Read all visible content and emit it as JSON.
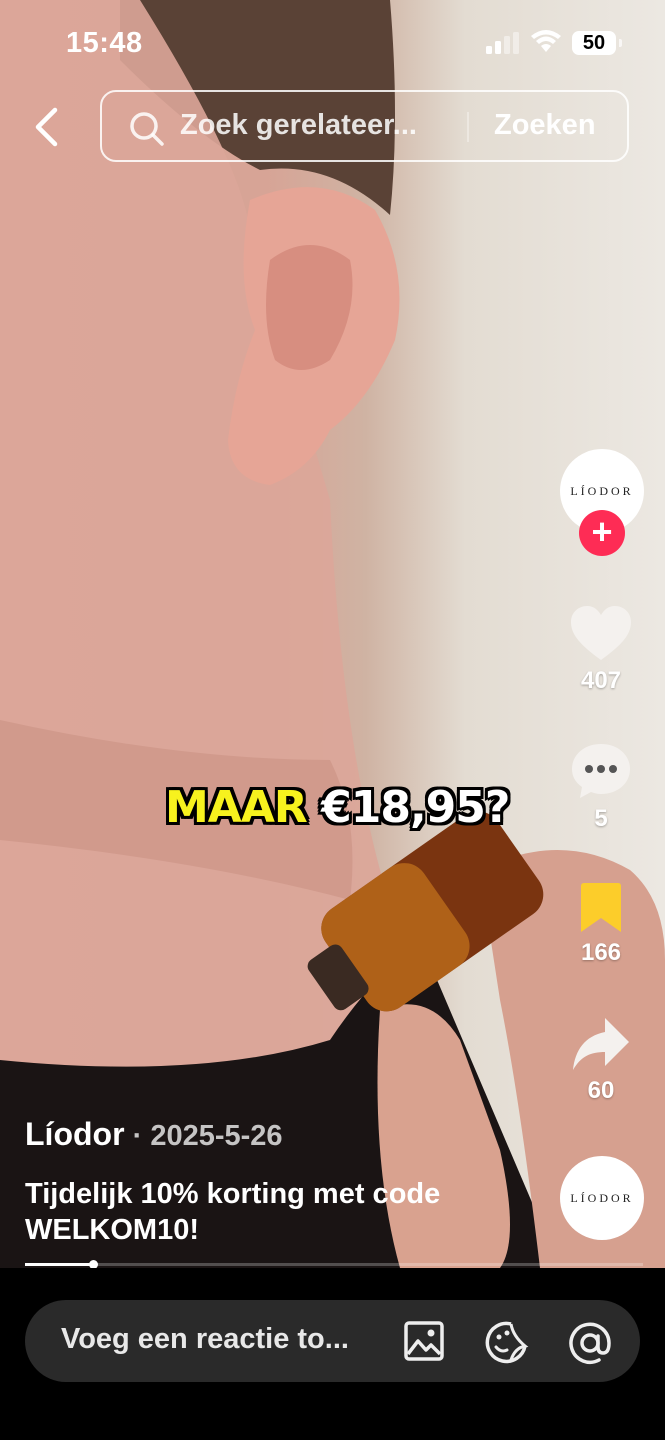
{
  "status": {
    "time": "15:48",
    "battery": "50"
  },
  "search": {
    "placeholder": "Zoek gerelateer...",
    "button_label": "Zoeken"
  },
  "video": {
    "caption_highlight": "MAAR",
    "caption_rest": "€18,95?"
  },
  "creator": {
    "avatar_text": "LÍODOR",
    "follow_label": "+"
  },
  "actions": {
    "likes": "407",
    "comments": "5",
    "saves": "166",
    "shares": "60"
  },
  "post": {
    "author": "Líodor",
    "separator": " · ",
    "date": "2025-5-26",
    "description": "Tijdelijk 10% korting met code WELKOM10!"
  },
  "music": {
    "disc_text": "LÍODOR"
  },
  "playback": {
    "progress": 0.11
  },
  "comment_bar": {
    "placeholder": "Voeg een reactie to..."
  },
  "icons": [
    "back-icon",
    "search-icon",
    "heart-icon",
    "comment-icon",
    "bookmark-icon",
    "share-icon",
    "image-icon",
    "emoji-icon",
    "mention-icon"
  ],
  "colors": {
    "accent": "#fe2c55",
    "bookmark": "#fccd2a",
    "caption": "#f7f21e"
  }
}
